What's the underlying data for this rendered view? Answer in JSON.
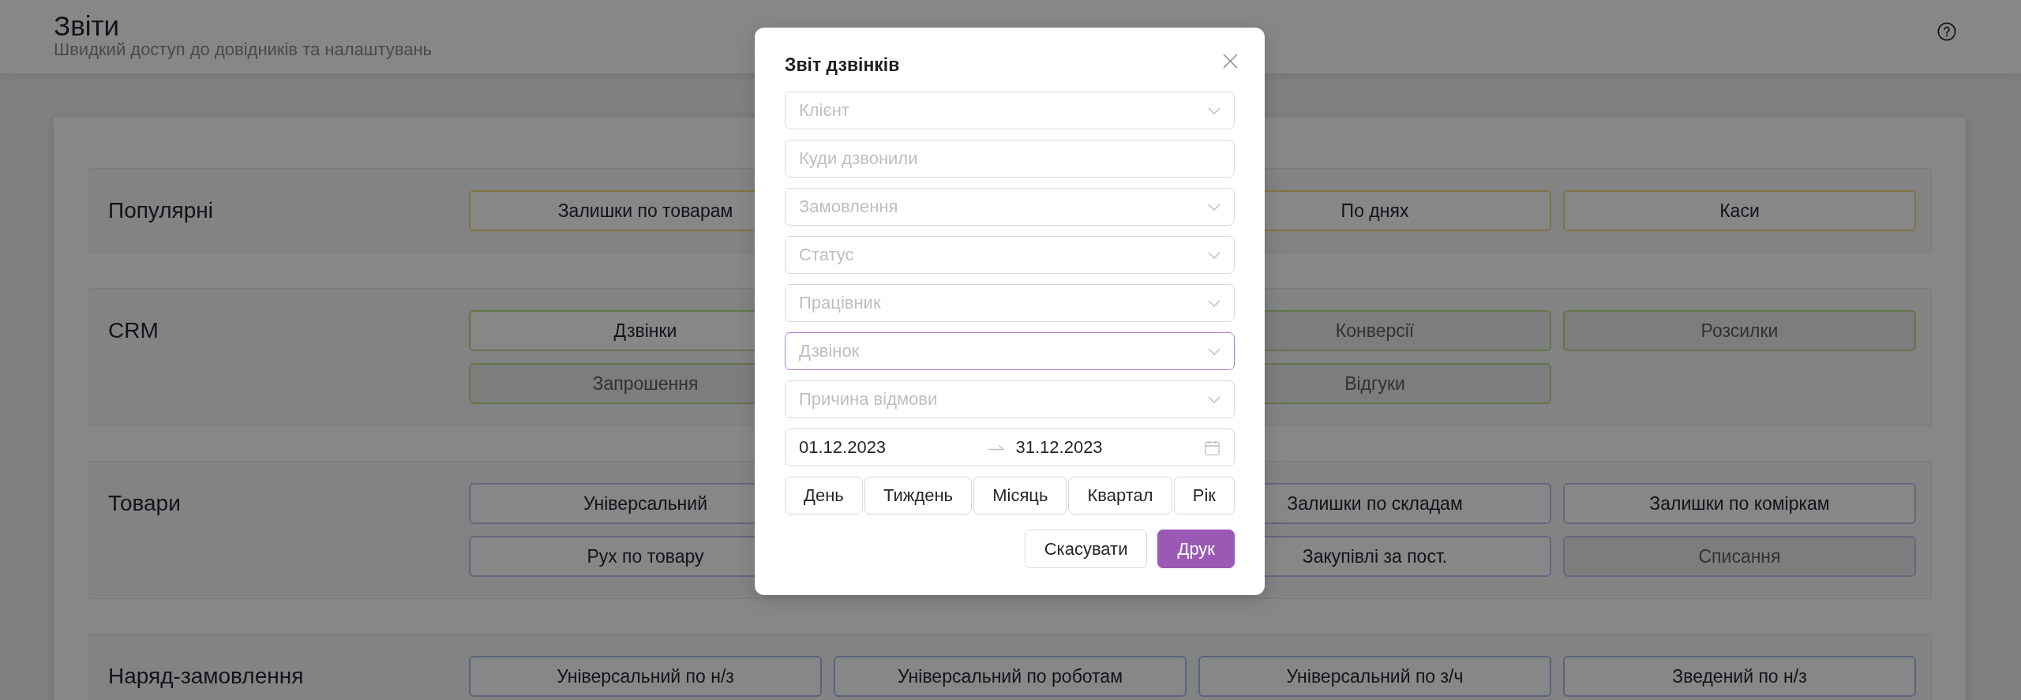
{
  "header": {
    "title": "Звіти",
    "subtitle": "Швидкий доступ до довідників та налаштувань"
  },
  "sections": [
    {
      "title": "Популярні",
      "color": "#7e753f",
      "rows": [
        {
          "column_1": {
            "label": "Залишки по товарам",
            "disabled": false
          },
          "column_3": {
            "label": "По днях",
            "disabled": false
          },
          "column_4": {
            "label": "Каси",
            "disabled": false
          }
        }
      ]
    },
    {
      "title": "CRM",
      "color": "#637548",
      "rows": [
        {
          "column_1": {
            "label": "Дзвінки",
            "disabled": false
          },
          "column_3": {
            "label": "Конверсії",
            "disabled": true
          },
          "column_4": {
            "label": "Розсилки",
            "disabled": true
          }
        },
        {
          "column_1": {
            "label": "Запрошення",
            "disabled": true
          },
          "column_3": {
            "label": "Відгуки",
            "disabled": true
          }
        }
      ]
    },
    {
      "title": "Товари",
      "color": "#6c637e",
      "rows": [
        {
          "column_1": {
            "label": "Універсальний",
            "disabled": false
          },
          "column_3": {
            "label": "Залишки по складам",
            "disabled": false
          },
          "column_4": {
            "label": "Залишки по коміркам",
            "disabled": false
          }
        },
        {
          "column_1": {
            "label": "Рух по товару",
            "disabled": false
          },
          "column_3": {
            "label": "Закупівлі за пост.",
            "disabled": false
          },
          "column_4": {
            "label": "Списання",
            "disabled": true
          }
        }
      ]
    },
    {
      "title": "Наряд-замовлення",
      "color": "#5a637e",
      "rows": [
        {
          "column_1": {
            "label": "Універсальний по н/з",
            "disabled": false
          },
          "column_2": {
            "label": "Універсальний по роботам",
            "disabled": false
          },
          "column_3": {
            "label": "Універсальний по з/ч",
            "disabled": false
          },
          "column_4": {
            "label": "Зведений по н/з",
            "disabled": false
          }
        }
      ]
    }
  ],
  "dialog": {
    "title": "Звіт дзвінків",
    "fields": [
      {
        "kind": "select",
        "placeholder": "Клієнт",
        "focused": false
      },
      {
        "kind": "text",
        "placeholder": "Куди дзвонили",
        "focused": false
      },
      {
        "kind": "select",
        "placeholder": "Замовлення",
        "focused": false
      },
      {
        "kind": "select",
        "placeholder": "Статус",
        "focused": false
      },
      {
        "kind": "select",
        "placeholder": "Працівник",
        "focused": false
      },
      {
        "kind": "select",
        "placeholder": "Дзвінок",
        "focused": true
      },
      {
        "kind": "select",
        "placeholder": "Причина відмови",
        "focused": false
      }
    ],
    "date_range": {
      "start": "01.12.2023",
      "end": "31.12.2023"
    },
    "periods": [
      "День",
      "Тиждень",
      "Місяць",
      "Квартал",
      "Рік"
    ],
    "buttons": [
      {
        "label": "Скасувати",
        "kind": "secondary"
      },
      {
        "label": "Друк",
        "kind": "primary"
      }
    ]
  }
}
